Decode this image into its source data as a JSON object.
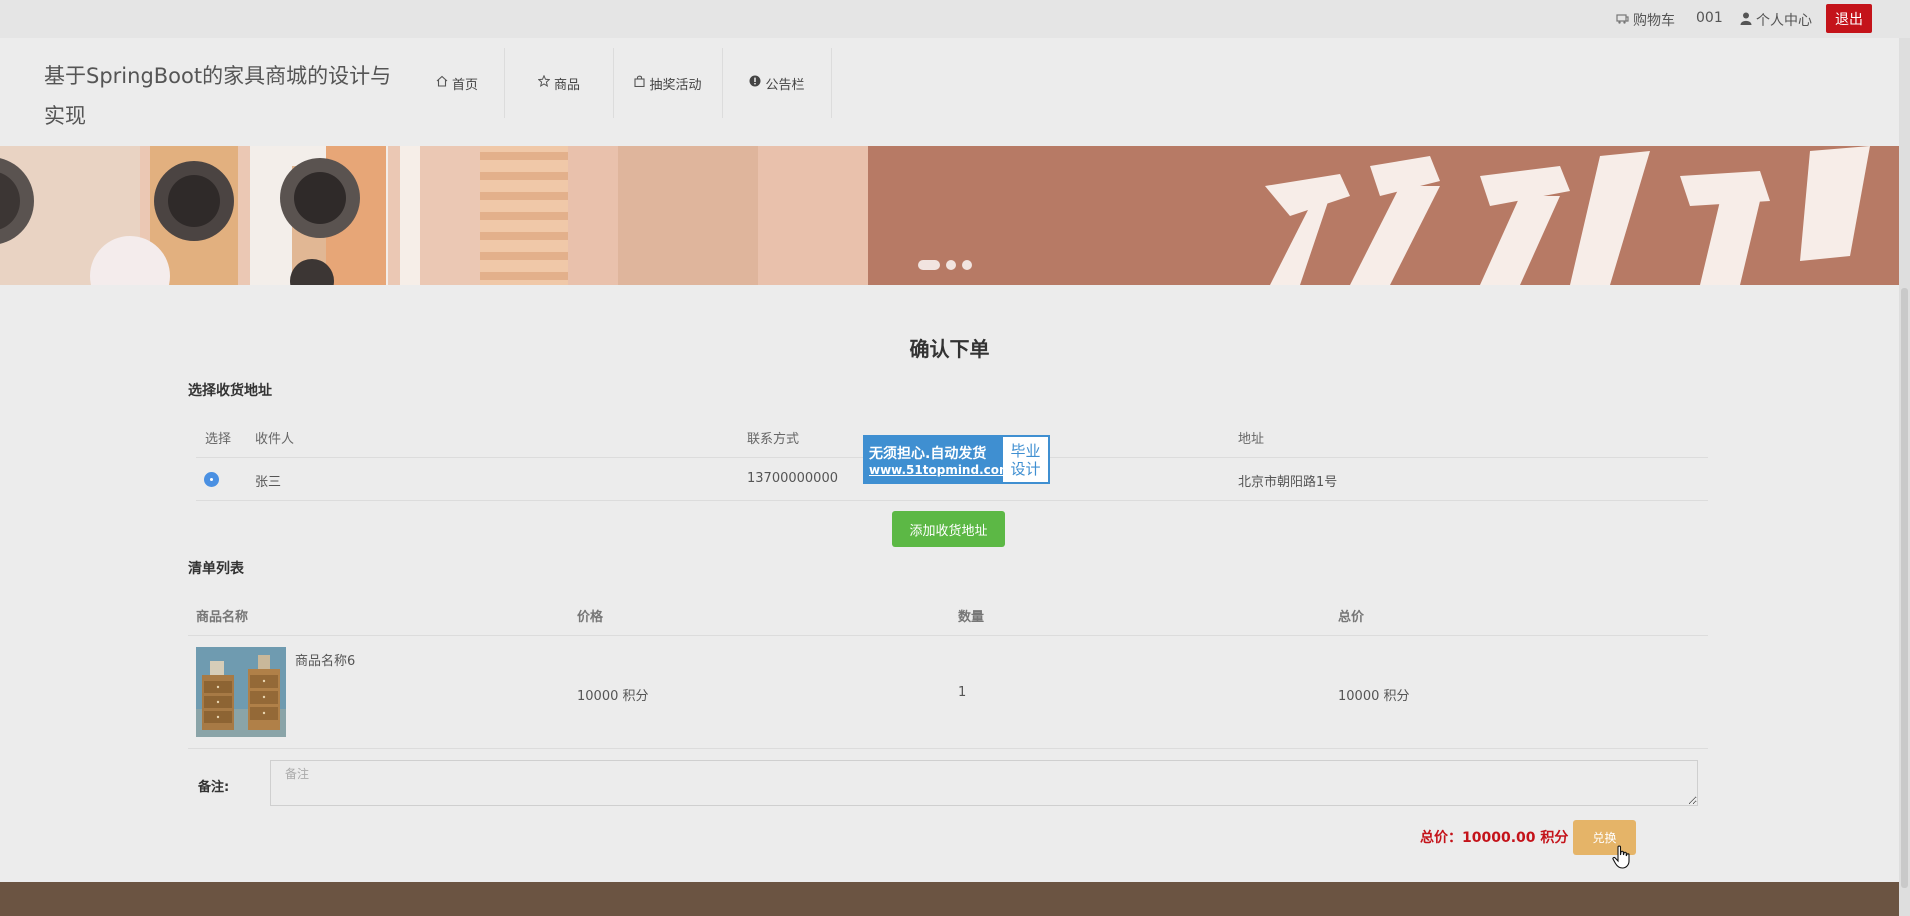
{
  "topbar": {
    "cart_label": "购物车",
    "username": "001",
    "profile_label": "个人中心",
    "logout_label": "退出"
  },
  "header": {
    "site_title": "基于SpringBoot的家具商城的设计与实现",
    "nav": [
      {
        "label": "首页",
        "icon": "home-icon"
      },
      {
        "label": "商品",
        "icon": "star-icon"
      },
      {
        "label": "抽奖活动",
        "icon": "bag-icon"
      },
      {
        "label": "公告栏",
        "icon": "info-icon"
      }
    ]
  },
  "banner": {
    "slides": 3,
    "active_slide": 1
  },
  "page_title": "确认下单",
  "address_section": {
    "title": "选择收货地址",
    "columns": [
      "选择",
      "收件人",
      "联系方式",
      "地址"
    ],
    "rows": [
      {
        "name": "张三",
        "phone": "13700000000",
        "address": "北京市朝阳路1号",
        "selected": true
      }
    ],
    "add_button": "添加收货地址"
  },
  "watermark": {
    "line1": "无须担心.自动发货",
    "line2": "www.51topmind.com",
    "right1": "毕业",
    "right2": "设计"
  },
  "order_section": {
    "title": "清单列表",
    "columns": [
      "商品名称",
      "价格",
      "数量",
      "总价"
    ],
    "items": [
      {
        "name": "商品名称6",
        "price": "10000 积分",
        "quantity": "1",
        "total": "10000 积分"
      }
    ]
  },
  "remark": {
    "label": "备注:",
    "placeholder": "备注"
  },
  "summary": {
    "total_label": "总价：",
    "total_value": "10000.00 积分",
    "submit_label": "兑换"
  },
  "colors": {
    "accent_red": "#c4131a",
    "green": "#5cb845",
    "gold": "#e5b468",
    "footer": "#6b5442"
  }
}
